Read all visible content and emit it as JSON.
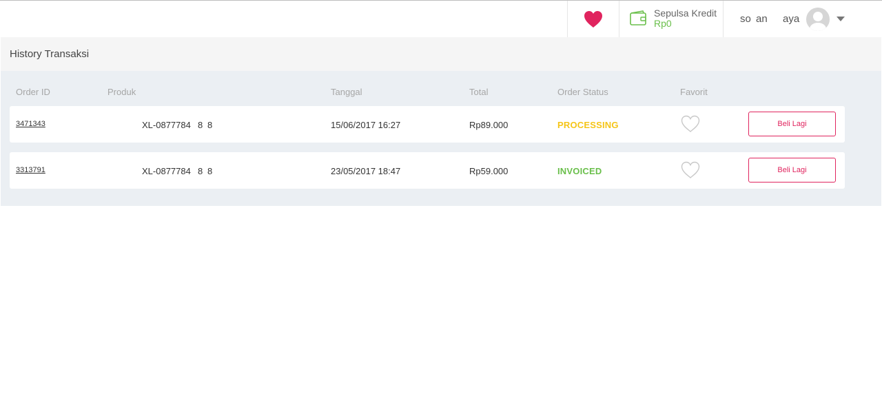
{
  "header": {
    "credit_label": "Sepulsa Kredit",
    "credit_amount": "Rp0",
    "user_name_1": "so an",
    "user_name_2": "aya"
  },
  "colors": {
    "brand_pink": "#e0245e",
    "credit_green": "#6abf4b",
    "processing": "#f5c518",
    "invoiced": "#6abf4b"
  },
  "history": {
    "title": "History Transaksi",
    "columns": [
      "Order ID",
      "Produk",
      "Tanggal",
      "Total",
      "Order Status",
      "Favorit"
    ],
    "rows": [
      {
        "order_id": "3471343",
        "product": "XL-0877784",
        "product_suffix": "8",
        "product_suffix2": "8",
        "date": "15/06/2017 16:27",
        "total": "Rp89.000",
        "status": "PROCESSING",
        "buy_label": "Beli Lagi"
      },
      {
        "order_id": "3313791",
        "product": "XL-0877784",
        "product_suffix": "8",
        "product_suffix2": "8",
        "date": "23/05/2017 18:47",
        "total": "Rp59.000",
        "status": "INVOICED",
        "buy_label": "Beli Lagi"
      }
    ]
  },
  "icons": {
    "favorites": "heart-icon",
    "wallet": "wallet-icon",
    "avatar": "user-avatar-icon",
    "dropdown": "chevron-down-icon",
    "row_favorite": "heart-outline-icon"
  }
}
